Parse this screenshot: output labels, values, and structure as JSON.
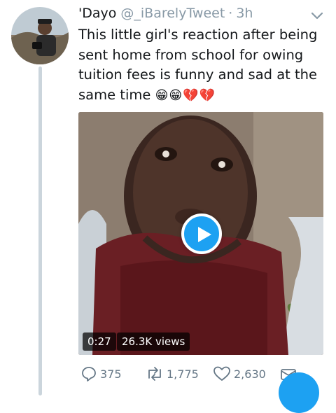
{
  "tweet": {
    "display_name": "'Dayo",
    "handle": "@_iBarelyTweet",
    "separator": "·",
    "time": "3h",
    "text": "This little girl's reaction after being sent home from school for owing tuition fees is funny and sad at the same time",
    "emojis": "😁😁💔💔",
    "avatar_icon": "profile-photo"
  },
  "media": {
    "duration": "0:27",
    "views": "26.3K views",
    "play_icon": "play-icon"
  },
  "actions": {
    "replies": "375",
    "retweets": "1,775",
    "likes": "2,630"
  },
  "colors": {
    "accent": "#1da1f2",
    "muted": "#8899a6",
    "thread_line": "#cbd5dc"
  }
}
